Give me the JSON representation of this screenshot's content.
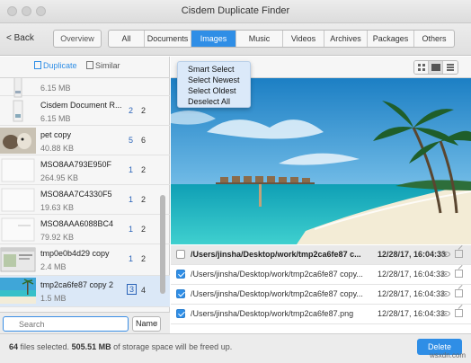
{
  "window": {
    "title": "Cisdem Duplicate Finder"
  },
  "toolbar": {
    "back_label": "< Back",
    "overview_label": "Overview",
    "tabs": [
      {
        "label": "All",
        "active": false
      },
      {
        "label": "Documents",
        "active": false
      },
      {
        "label": "Images",
        "active": true
      },
      {
        "label": "Music",
        "active": false
      },
      {
        "label": "Videos",
        "active": false
      },
      {
        "label": "Archives",
        "active": false
      },
      {
        "label": "Packages",
        "active": false
      },
      {
        "label": "Others",
        "active": false
      }
    ]
  },
  "sidebar": {
    "mode_duplicate": "Duplicate",
    "mode_similar": "Similar",
    "items": [
      {
        "name": "",
        "size": "6.15 MB",
        "count_a": "",
        "count_b": "",
        "thumb": "doc"
      },
      {
        "name": "Cisdem Document R...",
        "size": "6.15 MB",
        "count_a": "2",
        "count_b": "2",
        "thumb": "doc"
      },
      {
        "name": "pet copy",
        "size": "40.88 KB",
        "count_a": "5",
        "count_b": "6",
        "thumb": "pet"
      },
      {
        "name": "MSO8AA793E950F",
        "size": "264.95 KB",
        "count_a": "1",
        "count_b": "2",
        "thumb": "blank"
      },
      {
        "name": "MSO8AA7C4330F5",
        "size": "19.63 KB",
        "count_a": "1",
        "count_b": "2",
        "thumb": "blank"
      },
      {
        "name": "MSO8AAA6088BC4",
        "size": "79.92 KB",
        "count_a": "1",
        "count_b": "2",
        "thumb": "blank"
      },
      {
        "name": "tmp0e0b4d29 copy",
        "size": "2.4 MB",
        "count_a": "1",
        "count_b": "2",
        "thumb": "screen"
      },
      {
        "name": "tmp2ca6fe87 copy 2",
        "size": "1.5 MB",
        "count_a": "3",
        "count_b": "4",
        "thumb": "beach",
        "selected": true
      }
    ],
    "search_placeholder": "Search",
    "sort_label": "Name"
  },
  "select_menu": {
    "items": [
      "Smart Select",
      "Select Newest",
      "Select Oldest",
      "Deselect All"
    ]
  },
  "files": {
    "header": {
      "path": "/Users/jinsha/Desktop/work/tmp2ca6fe87 c...",
      "date": "12/28/17, 16:04:33",
      "checked": false
    },
    "rows": [
      {
        "path": "/Users/jinsha/Desktop/work/tmp2ca6fe87 copy...",
        "date": "12/28/17, 16:04:33",
        "checked": true
      },
      {
        "path": "/Users/jinsha/Desktop/work/tmp2ca6fe87 copy...",
        "date": "12/28/17, 16:04:33",
        "checked": true
      },
      {
        "path": "/Users/jinsha/Desktop/work/tmp2ca6fe87.png",
        "date": "12/28/17, 16:04:33",
        "checked": true
      }
    ]
  },
  "status": {
    "count": "64",
    "count_suffix": "files selected.",
    "size": "505.51 MB",
    "size_suffix": "of storage space will be freed up."
  },
  "delete_label": "Delete",
  "watermark": "wsxdn.com",
  "colors": {
    "accent": "#2f8ee6",
    "menu_bg": "#dbe9f9"
  }
}
